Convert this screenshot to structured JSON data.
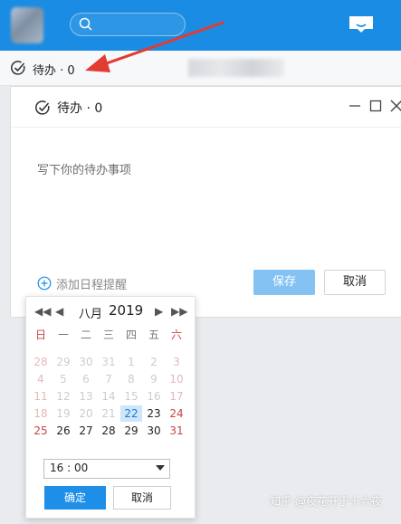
{
  "top_bar": {
    "background": "#1a8ce3"
  },
  "todo_row": {
    "label": "待办 · 0"
  },
  "panel": {
    "title": "待办 · 0",
    "placeholder": "写下你的待办事项",
    "add_reminder_label": "添加日程提醒",
    "save_label": "保存",
    "cancel_label": "取消"
  },
  "calendar": {
    "month": "八月",
    "year": "2019",
    "weekdays": [
      "日",
      "一",
      "二",
      "三",
      "四",
      "五",
      "六"
    ],
    "weeks": [
      [
        "28",
        "29",
        "30",
        "31",
        "1",
        "2",
        "3"
      ],
      [
        "4",
        "5",
        "6",
        "7",
        "8",
        "9",
        "10"
      ],
      [
        "11",
        "12",
        "13",
        "14",
        "15",
        "16",
        "17"
      ],
      [
        "18",
        "19",
        "20",
        "21",
        "22",
        "23",
        "24"
      ],
      [
        "25",
        "26",
        "27",
        "28",
        "29",
        "30",
        "31"
      ]
    ],
    "selected_day": "22",
    "time_value": "16 : 00",
    "ok_label": "确定",
    "cancel_label": "取消"
  },
  "watermark": "知乎 @夜花开于十六夜",
  "colors": {
    "accent": "#1a8ce3",
    "arrow": "#e23b32",
    "selected_day_bg": "#cde6fb"
  }
}
